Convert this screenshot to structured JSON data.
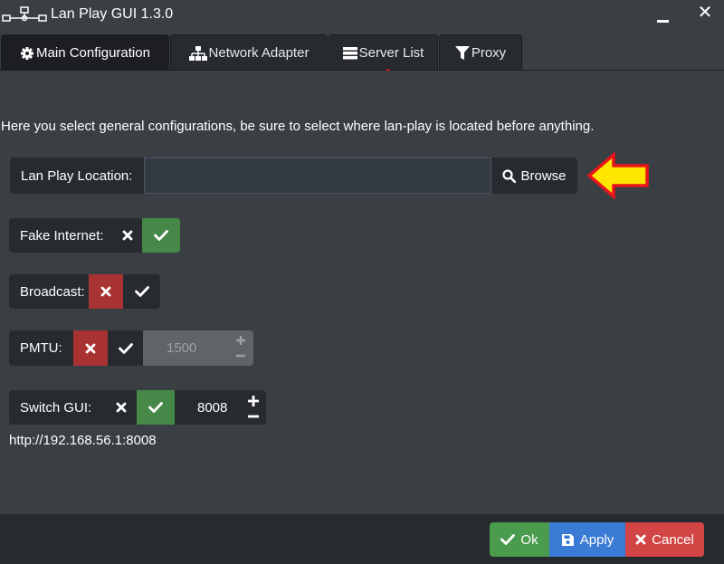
{
  "window": {
    "title": "Lan Play GUI 1.3.0",
    "close_glyph": "✕"
  },
  "tabs": [
    {
      "label": "Main Configuration",
      "icon": "gear-icon",
      "active": true
    },
    {
      "label": "Network Adapter",
      "icon": "network-icon",
      "active": false
    },
    {
      "label": "Server List",
      "icon": "server-icon",
      "active": false
    },
    {
      "label": "Proxy",
      "icon": "filter-icon",
      "active": false
    }
  ],
  "main": {
    "description": "Here you select general configurations, be sure to select where lan-play is located before anything.",
    "location": {
      "label": "Lan Play Location:",
      "value": "",
      "browse_label": "Browse"
    },
    "fake_internet": {
      "label": "Fake Internet:",
      "enabled": true
    },
    "broadcast": {
      "label": "Broadcast:",
      "enabled": false
    },
    "pmtu": {
      "label": "PMTU:",
      "enabled": false,
      "value": "1500"
    },
    "switch_gui": {
      "label": "Switch GUI:",
      "enabled": true,
      "port": "8008",
      "url": "http://192.168.56.1:8008"
    }
  },
  "footer": {
    "ok_label": "Ok",
    "apply_label": "Apply",
    "cancel_label": "Cancel"
  },
  "annotations": {
    "arrow_color": "#ffe600",
    "arrow_border": "#e8141c"
  },
  "colors": {
    "window_bg": "#3a3f44",
    "panel_dark": "#272b30",
    "success": "#468847",
    "danger": "#a93232",
    "primary": "#3a7bd5"
  }
}
